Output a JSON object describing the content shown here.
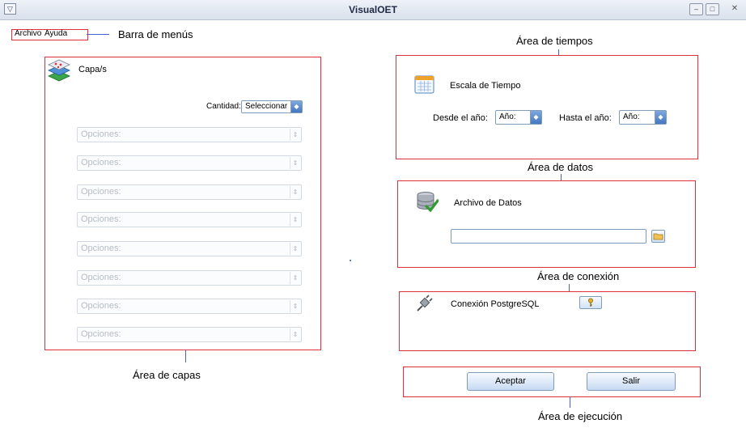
{
  "window": {
    "title": "VisualOET",
    "sys_menu_glyph": "▽",
    "min_glyph": "–",
    "max_glyph": "□",
    "close_glyph": "✕"
  },
  "menubar": {
    "items": [
      "Archivo",
      "Ayuda"
    ]
  },
  "annotations": {
    "menu_bar": "Barra de menús",
    "time_area": "Área de tiempos",
    "data_area": "Área de datos",
    "connection_area": "Área de conexión",
    "layers_area": "Área de capas",
    "execution_area": "Área de ejecución"
  },
  "layers": {
    "title": "Capa/s",
    "icon": "layers-icon",
    "quantity_label": "Cantidad:",
    "quantity_value": "Seleccionar",
    "options": [
      "Opciones:",
      "Opciones:",
      "Opciones:",
      "Opciones:",
      "Opciones:",
      "Opciones:",
      "Opciones:",
      "Opciones:"
    ]
  },
  "time_scale": {
    "title": "Escala de Tiempo",
    "icon": "calendar-icon",
    "from_label": "Desde el año:",
    "from_value": "Año:",
    "to_label": "Hasta el año:",
    "to_value": "Año:"
  },
  "data_file": {
    "title": "Archivo de Datos",
    "icon": "database-check-icon",
    "path_value": "",
    "browse_icon": "folder-icon"
  },
  "connection": {
    "title": "Conexión PostgreSQL",
    "icon": "plug-icon",
    "key_icon": "key-icon"
  },
  "execution": {
    "accept_label": "Aceptar",
    "exit_label": "Salir"
  },
  "colors": {
    "annotation_box": "#e0303c",
    "annotation_line": "#4a5fd0",
    "button_gradient_top": "#f7fafe",
    "button_gradient_bottom": "#c7daf3"
  }
}
